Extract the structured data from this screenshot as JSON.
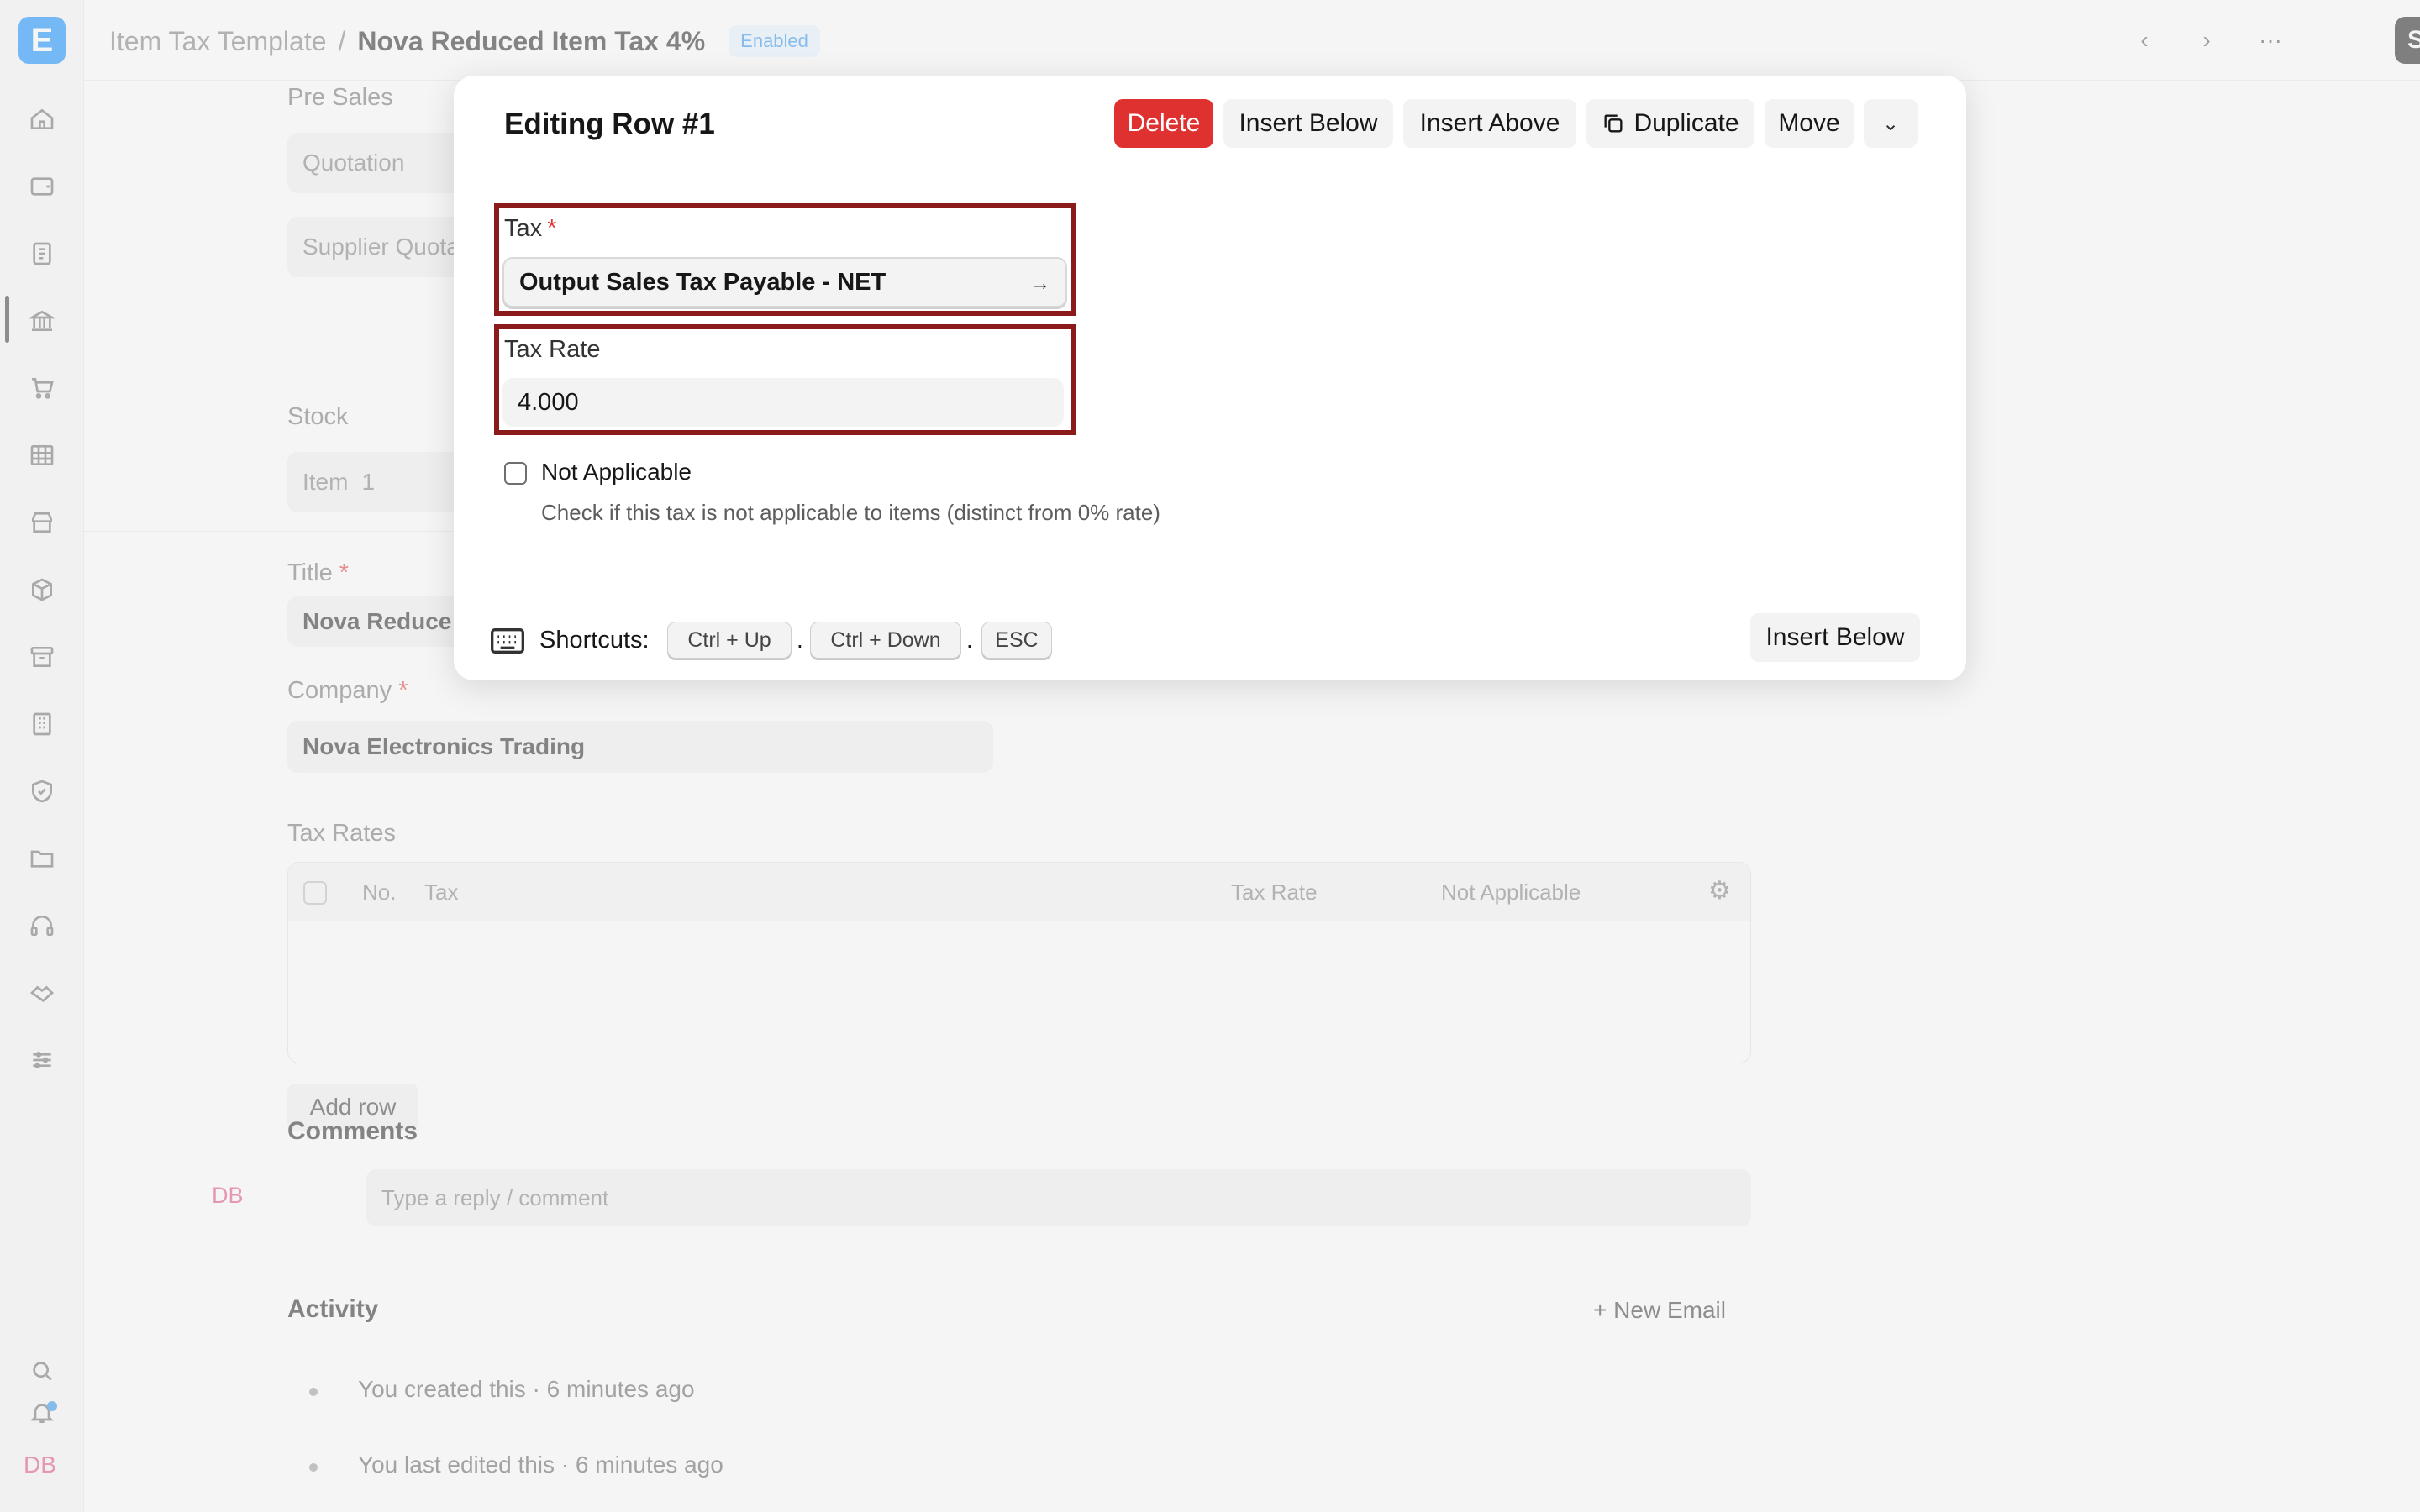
{
  "app": {
    "logo_letter": "E",
    "user_initials": "DB",
    "breadcrumb_parent": "Item Tax Template",
    "breadcrumb_sep": "/",
    "doc_title": "Nova Reduced Item Tax 4%",
    "status": "Enabled",
    "save_label": "Save"
  },
  "form": {
    "pre_sales_label": "Pre Sales",
    "quotation": "Quotation",
    "supplier_quotation": "Supplier Quota",
    "stock_label": "Stock",
    "item_label": "Item",
    "item_count": "1",
    "title_label": "Title",
    "title_value": "Nova Reduce",
    "company_label": "Company",
    "company_value": "Nova Electronics Trading",
    "tax_rates_label": "Tax Rates",
    "grid_cols": [
      "No.",
      "Tax",
      "Tax Rate",
      "Not Applicable"
    ],
    "add_row": "Add row",
    "comments_label": "Comments",
    "comment_avatar": "DB",
    "comment_placeholder": "Type a reply / comment",
    "activity_label": "Activity",
    "new_email": "+ New Email",
    "activity": [
      "You created this · 6 minutes ago",
      "You last edited this · 6 minutes ago"
    ],
    "required_mark": "*"
  },
  "dialog": {
    "title": "Editing Row #1",
    "delete": "Delete",
    "insert_below": "Insert Below",
    "insert_above": "Insert Above",
    "duplicate": "Duplicate",
    "move": "Move",
    "tax_label": "Tax",
    "tax_value": "Output Sales Tax Payable - NET",
    "tax_rate_label": "Tax Rate",
    "tax_rate_value": "4.000",
    "not_applicable_label": "Not Applicable",
    "not_applicable_desc": "Check if this tax is not applicable to items (distinct from 0% rate)",
    "shortcuts_label": "Shortcuts:",
    "shortcut_keys": [
      "Ctrl + Up",
      "Ctrl + Down",
      "ESC"
    ],
    "shortcut_sep": ".",
    "footer_insert_below": "Insert Below",
    "highlight_color": "#8b1a1a"
  }
}
